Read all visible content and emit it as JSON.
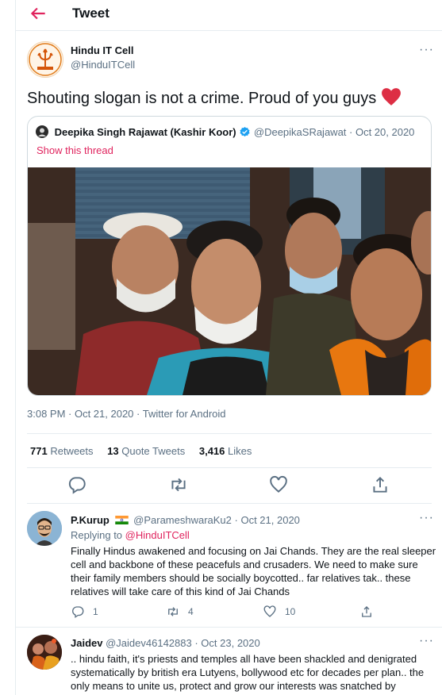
{
  "header": {
    "title": "Tweet"
  },
  "tweet": {
    "display_name": "Hindu IT Cell",
    "handle": "@HinduITCell",
    "text": "Shouting slogan is not a crime. Proud of you guys",
    "timestamp": "3:08 PM · Oct 21, 2020 · Twitter for Android",
    "stats": {
      "retweets_count": "771",
      "retweets_label": "Retweets",
      "quotes_count": "13",
      "quotes_label": "Quote Tweets",
      "likes_count": "3,416",
      "likes_label": "Likes"
    }
  },
  "quote": {
    "display_name": "Deepika Singh Rajawat (Kashir Koor)",
    "handle": "@DeepikaSRajawat",
    "date": "· Oct 20, 2020",
    "show_thread": "Show this thread"
  },
  "replies": [
    {
      "display_name": "P.Kurup",
      "handle": "@ParameshwaraKu2",
      "date": "· Oct 21, 2020",
      "replying_to_label": "Replying to",
      "replying_to": "@HinduITCell",
      "text": "Finally Hindus awakened and focusing on Jai Chands. They are the real sleeper cell and backbone of these peacefuls and crusaders. We need to make sure their family members should be socially boycotted.. far relatives tak.. these relatives will take care of this kind of Jai Chands",
      "reply_count": "1",
      "retweet_count": "4",
      "like_count": "10"
    },
    {
      "display_name": "Jaidev",
      "handle": "@Jaidev46142883",
      "date": "· Oct 23, 2020",
      "text": ".. hindu faith, it's priests and temples all have been shackled and denigrated systematically by british era Lutyens, bollywood etc for decades per plan.. the only means to unite us, protect and grow our interests was snatched by"
    }
  ],
  "colors": {
    "accent": "#e0245e",
    "text": "#0f1419",
    "muted": "#5b7083",
    "border": "#e6ecf0",
    "verified": "#1da1f2"
  },
  "icons": [
    "back-arrow-icon",
    "more-icon",
    "heart-emoji-icon",
    "verified-badge-icon",
    "reply-icon",
    "retweet-icon",
    "like-icon",
    "share-icon",
    "india-flag-icon"
  ]
}
